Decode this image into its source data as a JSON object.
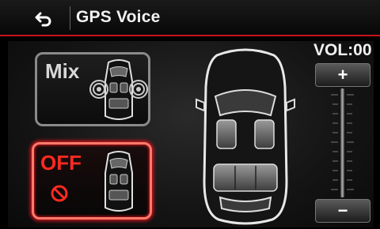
{
  "header": {
    "title": "GPS Voice"
  },
  "modes": {
    "mix_label": "Mix",
    "off_label": "OFF",
    "selected": "OFF"
  },
  "volume": {
    "label": "VOL:00",
    "value": 0,
    "plus_label": "+",
    "minus_label": "−"
  },
  "colors": {
    "accent": "#c8141e",
    "selected_border": "#ff7a6a",
    "off_text": "#ff2a22",
    "card_border": "#8a8a8a"
  },
  "icons": [
    "back-icon",
    "speaker-icon",
    "no-entry-icon",
    "car-top-view-icon"
  ]
}
